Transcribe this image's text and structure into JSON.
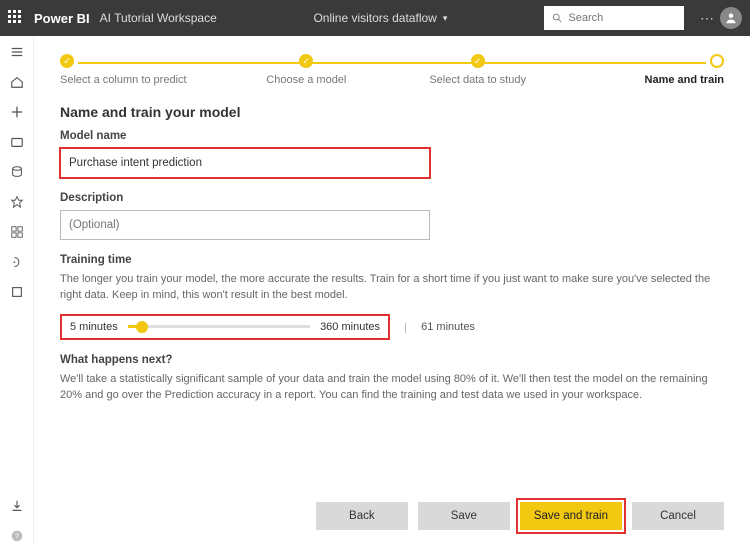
{
  "header": {
    "brand": "Power BI",
    "workspace": "AI Tutorial Workspace",
    "dataflow": "Online visitors dataflow",
    "search_placeholder": "Search"
  },
  "stepper": {
    "steps": [
      {
        "label": "Select a column to predict",
        "done": true
      },
      {
        "label": "Choose a model",
        "done": true
      },
      {
        "label": "Select data to study",
        "done": true
      },
      {
        "label": "Name and train",
        "done": false,
        "current": true
      }
    ]
  },
  "page": {
    "title": "Name and train your model",
    "model_name_label": "Model name",
    "model_name_value": "Purchase intent prediction",
    "description_label": "Description",
    "description_placeholder": "(Optional)",
    "training_time_label": "Training time",
    "training_time_help": "The longer you train your model, the more accurate the results. Train for a short time if you just want to make sure you've selected the right data. Keep in mind, this won't result in the best model.",
    "slider_min": "5 minutes",
    "slider_max": "360 minutes",
    "slider_value": "61 minutes",
    "what_next_label": "What happens next?",
    "what_next_body": "We'll take a statistically significant sample of your data and train the model using 80% of it. We'll then test the model on the remaining 20% and go over the Prediction accuracy in a report. You can find the training and test data we used in your workspace."
  },
  "buttons": {
    "back": "Back",
    "save": "Save",
    "save_train": "Save and train",
    "cancel": "Cancel"
  }
}
